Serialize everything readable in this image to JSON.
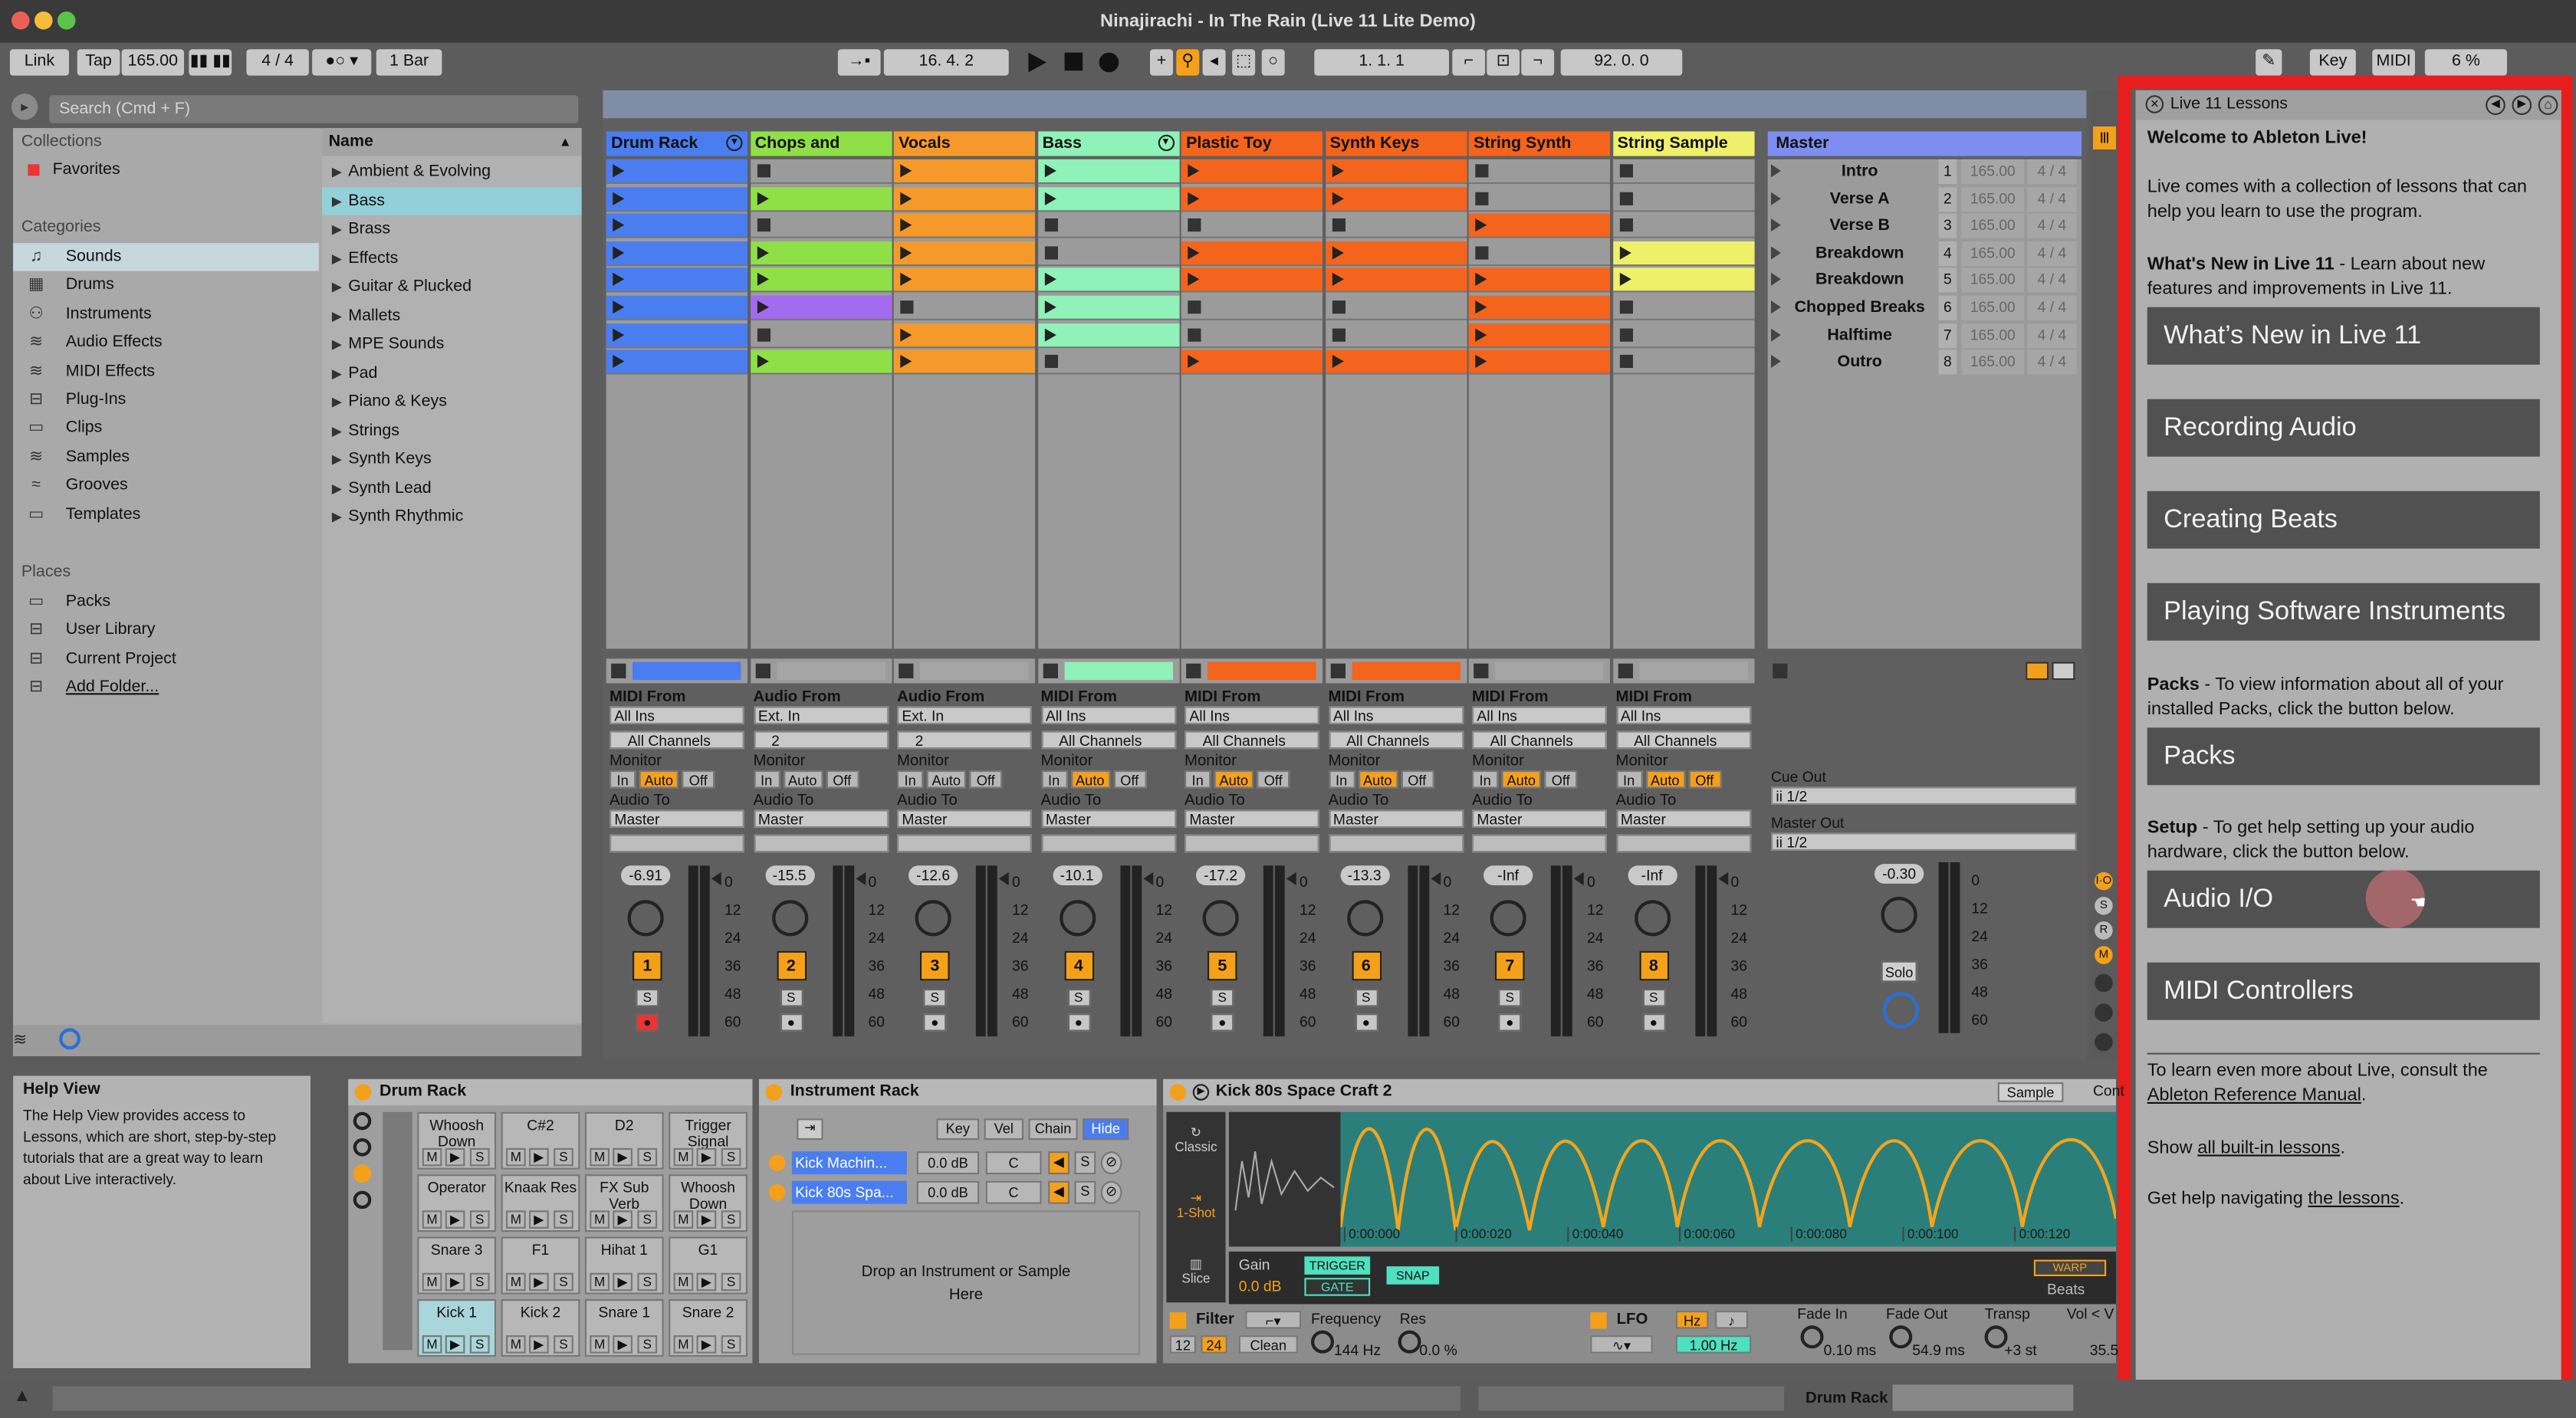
{
  "window": {
    "title": "Ninajirachi - In The Rain (Live 11 Lite Demo)"
  },
  "control": {
    "link": "Link",
    "tap": "Tap",
    "tempo": "165.00",
    "sig": "4 / 4",
    "quant": "1 Bar",
    "position": "16.   4.   2",
    "loop_start": "1.   1.   1",
    "loop_len": "92.   0.   0",
    "key": "Key",
    "midi": "MIDI",
    "cpu": "6 %"
  },
  "browser": {
    "search_placeholder": "Search (Cmd + F)",
    "collections_label": "Collections",
    "favorites": "Favorites",
    "categories_label": "Categories",
    "categories": [
      "Sounds",
      "Drums",
      "Instruments",
      "Audio Effects",
      "MIDI Effects",
      "Plug-Ins",
      "Clips",
      "Samples",
      "Grooves",
      "Templates"
    ],
    "category_icons": [
      "♫",
      "▦",
      "⚇",
      "≋",
      "≋",
      "⊟",
      "▭",
      "≋",
      "≈",
      "▭"
    ],
    "places_label": "Places",
    "places": [
      "Packs",
      "User Library",
      "Current Project",
      "Add Folder..."
    ],
    "name_header": "Name",
    "names": [
      "Ambient & Evolving",
      "Bass",
      "Brass",
      "Effects",
      "Guitar & Plucked",
      "Mallets",
      "MPE Sounds",
      "Pad",
      "Piano & Keys",
      "Strings",
      "Synth Keys",
      "Synth Lead",
      "Synth Rhythmic"
    ]
  },
  "tracks": [
    {
      "name": "Drum Rack",
      "color": "#4a7df0",
      "input_label": "MIDI From",
      "in1": "All Ins",
      "in2": "All Channels",
      "vol": "-6.91",
      "num": "1"
    },
    {
      "name": "Chops and Breaks",
      "color": "#8ee046",
      "input_label": "Audio From",
      "in1": "Ext. In",
      "in2": "2",
      "vol": "-15.5",
      "num": "2"
    },
    {
      "name": "Vocals",
      "color": "#f59a2a",
      "input_label": "Audio From",
      "in1": "Ext. In",
      "in2": "2",
      "vol": "-12.6",
      "num": "3"
    },
    {
      "name": "Bass",
      "color": "#8ff2b8",
      "input_label": "MIDI From",
      "in1": "All Ins",
      "in2": "All Channels",
      "vol": "-10.1",
      "num": "4"
    },
    {
      "name": "Plastic Toy",
      "color": "#f4641c",
      "input_label": "MIDI From",
      "in1": "All Ins",
      "in2": "All Channels",
      "vol": "-17.2",
      "num": "5"
    },
    {
      "name": "Synth Keys",
      "color": "#f4641c",
      "input_label": "MIDI From",
      "in1": "All Ins",
      "in2": "All Channels",
      "vol": "-13.3",
      "num": "6"
    },
    {
      "name": "String Synth",
      "color": "#f4641c",
      "input_label": "MIDI From",
      "in1": "All Ins",
      "in2": "All Channels",
      "vol": "-Inf",
      "num": "7"
    },
    {
      "name": "String Sample",
      "color": "#eef06a",
      "input_label": "MIDI From",
      "in1": "All Ins",
      "in2": "All Channels",
      "vol": "-Inf",
      "num": "8"
    }
  ],
  "mixer": {
    "monitor": "Monitor",
    "in": "In",
    "auto": "Auto",
    "off": "Off",
    "audio_to": "Audio To",
    "dest": "Master",
    "s": "S",
    "meter_scale": [
      "0",
      "12",
      "24",
      "36",
      "48",
      "60"
    ]
  },
  "master": {
    "name": "Master",
    "cue_out": "Cue Out",
    "cue_val": "ii 1/2",
    "master_out": "Master Out",
    "master_val": "ii 1/2",
    "vol": "-0.30",
    "solo": "Solo",
    "scenes": [
      {
        "name": "Intro",
        "n": "1"
      },
      {
        "name": "Verse A",
        "n": "2"
      },
      {
        "name": "Verse B",
        "n": "3"
      },
      {
        "name": "Breakdown",
        "n": "4"
      },
      {
        "name": "Breakdown",
        "n": "5"
      },
      {
        "name": "Chopped Breaks",
        "n": "6"
      },
      {
        "name": "Halftime",
        "n": "7"
      },
      {
        "name": "Outro",
        "n": "8"
      }
    ],
    "scene_tempo": "165.00",
    "scene_sig": "4 / 4"
  },
  "lessons": {
    "title": "Live 11 Lessons",
    "welcome": "Welcome to Ableton Live!",
    "intro": "Live comes with a collection of lessons that can help you learn to use the program.",
    "whatsnew_label": "What's New in Live 11",
    "whatsnew_text": " - Learn about new features and improvements in Live 11.",
    "buttons": [
      "What’s New in Live 11",
      "Recording Audio",
      "Creating Beats",
      "Playing Software Instruments"
    ],
    "packs_label": "Packs",
    "packs_text": " - To view information about all of your installed Packs, click the button below.",
    "packs_button": "Packs",
    "setup_label": "Setup",
    "setup_text": " - To get help setting up your audio hardware, click the button below.",
    "audio_button": "Audio I/O",
    "midi_button": "MIDI Controllers",
    "more_pre": "To learn even more about Live, consult the",
    "manual_link": "Ableton Reference Manual",
    "show_pre": "Show",
    "builtin_link": "all built-in lessons",
    "help_pre": "Get help navigating",
    "lessons_link": "the lessons",
    "dot": "."
  },
  "help": {
    "title": "Help View",
    "text": "The Help View provides access to Lessons, which are short, step-by-step tutorials that are a great way to learn about Live interactively."
  },
  "drumrack": {
    "title": "Drum Rack",
    "pads": [
      "Whoosh Down",
      "C#2",
      "D2",
      "Trigger Signal",
      "Operator",
      "Knaak Res",
      "FX Sub Verb",
      "Whoosh Down",
      "Snare 3",
      "F1",
      "Hihat 1",
      "G1",
      "Kick 1",
      "Kick 2",
      "Snare 1",
      "Snare 2"
    ],
    "m": "M",
    "s": "S"
  },
  "instrack": {
    "title": "Instrument Rack",
    "key": "Key",
    "vel": "Vel",
    "chain": "Chain",
    "hide": "Hide",
    "chains": [
      {
        "name": "Kick Machin...",
        "db": "0.0 dB",
        "pan": "C"
      },
      {
        "name": "Kick 80s Spa...",
        "db": "0.0 dB",
        "pan": "C"
      }
    ],
    "drop": "Drop an Instrument or Sample Here"
  },
  "sampler": {
    "title": "Kick 80s Space Craft 2",
    "tab1": "Sample",
    "tab2": "Cont",
    "classic": "Classic",
    "oneshot": "1-Shot",
    "slice": "Slice",
    "gain": "Gain",
    "gain_val": "0.0 dB",
    "trigger": "TRIGGER",
    "gate": "GATE",
    "snap": "SNAP",
    "warp": "WARP",
    "beats": "Beats",
    "times": [
      "0:00:000",
      "0:00:020",
      "0:00:040",
      "0:00:060",
      "0:00:080",
      "0:00:100",
      "0:00:120"
    ],
    "filter": "Filter",
    "freq": "Frequency",
    "freq_val": "144 Hz",
    "res": "Res",
    "res_val": "0.0 %",
    "f12": "12",
    "f24": "24",
    "clean": "Clean",
    "lfo": "LFO",
    "hz": "Hz",
    "lfo_val": "1.00 Hz",
    "fadein": "Fade In",
    "fadein_val": "0.10 ms",
    "fadeout": "Fade Out",
    "fadeout_val": "54.9 ms",
    "transp": "Transp",
    "transp_val": "+3 st",
    "vol": "Vol < V",
    "vol_val": "35.5"
  },
  "status": {
    "track": "Drum Rack"
  }
}
